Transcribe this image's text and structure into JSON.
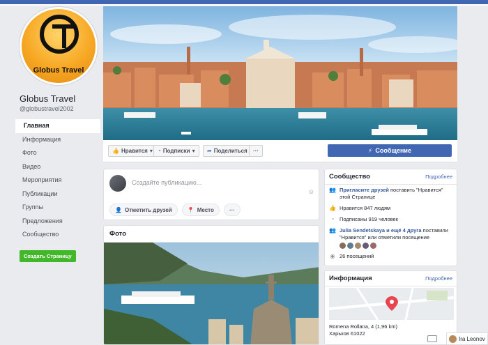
{
  "page": {
    "logo_text": "Globus Travel",
    "name": "Globus Travel",
    "handle": "@globustravel2002"
  },
  "nav": {
    "items": [
      {
        "label": "Главная",
        "active": true
      },
      {
        "label": "Информация"
      },
      {
        "label": "Фото"
      },
      {
        "label": "Видео"
      },
      {
        "label": "Мероприятия"
      },
      {
        "label": "Публикации"
      },
      {
        "label": "Группы"
      },
      {
        "label": "Предложения"
      },
      {
        "label": "Сообщество"
      }
    ],
    "create_page_label": "Создать Страницу"
  },
  "actions": {
    "like_label": "Нравится",
    "subscribe_label": "Подписки",
    "share_label": "Поделиться",
    "more_label": "···",
    "message_label": "Сообщение"
  },
  "composer": {
    "placeholder": "Создайте публикацию...",
    "tag_friends_label": "Отметить друзей",
    "place_label": "Место",
    "more_label": "···"
  },
  "photos": {
    "title": "Фото"
  },
  "community": {
    "title": "Сообщество",
    "more_label": "Подробнее",
    "invite_link": "Пригласите друзей",
    "invite_text": " поставить \"Нравится\" этой Странице",
    "likes_text": "Нравится 847 людям",
    "followers_text": "Подписаны 919 человек",
    "friends_link": "Julia Sendetskaya и ещё 4 друга",
    "friends_text": " поставили \"Нравится\" или отметили посещение",
    "visits_text": "26 посещений"
  },
  "info": {
    "title": "Информация",
    "more_label": "Подробнее",
    "address_line1": "Romena Rollana, 4 (1,96 km)",
    "address_line2": "Харьков 61022"
  },
  "chat": {
    "name": "Ira Leonov"
  },
  "colors": {
    "brand_blue": "#4267b2",
    "create_green": "#42b72a",
    "background": "#e9ebee"
  }
}
